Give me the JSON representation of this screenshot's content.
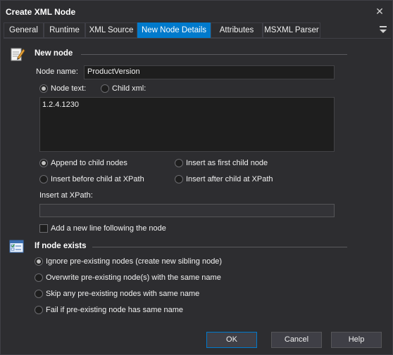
{
  "window": {
    "title": "Create XML Node"
  },
  "tabs": [
    {
      "label": "General"
    },
    {
      "label": "Runtime"
    },
    {
      "label": "XML Source"
    },
    {
      "label": "New Node Details"
    },
    {
      "label": "Attributes"
    },
    {
      "label": "MSXML Parser"
    }
  ],
  "active_tab": "New Node Details",
  "new_node": {
    "section_title": "New node",
    "node_name_label": "Node name:",
    "node_name_value": "ProductVersion",
    "node_text_label": "Node text:",
    "child_xml_label": "Child xml:",
    "content_mode_selected": "Node text",
    "node_text_value": "1.2.4.1230",
    "insert_options": [
      {
        "label": "Append to child nodes",
        "selected": true
      },
      {
        "label": "Insert as first child node",
        "selected": false
      },
      {
        "label": "Insert before child at XPath",
        "selected": false
      },
      {
        "label": "Insert after child at XPath",
        "selected": false
      }
    ],
    "insert_xpath_label": "Insert at XPath:",
    "insert_xpath_value": "",
    "new_line_label": "Add a new line following the node",
    "new_line_checked": false
  },
  "if_exists": {
    "section_title": "If node exists",
    "options": [
      {
        "label": "Ignore pre-existing nodes (create new sibling node)",
        "selected": true
      },
      {
        "label": "Overwrite pre-existing node(s) with the same name",
        "selected": false
      },
      {
        "label": "Skip any pre-existing nodes with same name",
        "selected": false
      },
      {
        "label": "Fail if pre-existing node has same name",
        "selected": false
      }
    ]
  },
  "buttons": {
    "ok": "OK",
    "cancel": "Cancel",
    "help": "Help"
  },
  "colors": {
    "accent": "#007acc",
    "background": "#2d2d30",
    "field": "#1e1e1e"
  }
}
